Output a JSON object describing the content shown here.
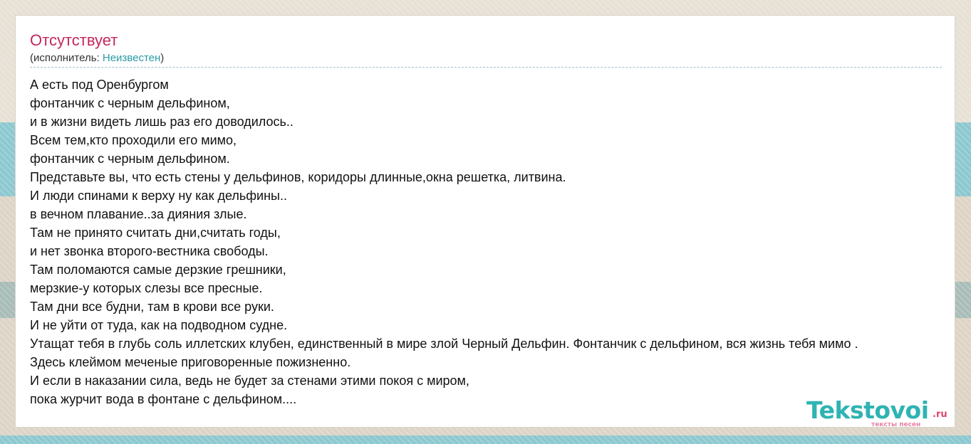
{
  "song": {
    "title": "Отсутствует",
    "artist_prefix": "(исполнитель: ",
    "artist": "Неизвестен",
    "artist_suffix": ")"
  },
  "lyrics": [
    "А есть под Оренбургом",
    "фонтанчик с черным дельфином,",
    "и в жизни видеть лишь раз его доводилось..",
    "Всем тем,кто проходили его мимо,",
    "фонтанчик с черным дельфином.",
    "Представьте вы, что есть стены у дельфинов, коридоры длинные,окна решетка, литвина.",
    "И люди спинами к верху ну как дельфины..",
    "в вечном плавание..за дияния злые.",
    "Там не принято считать дни,считать годы,",
    "и нет звонка второго-вестника свободы.",
    "Там поломаются самые дерзкие грешники,",
    "мерзкие-у которых слезы все пресные.",
    "Там дни все будни, там в крови все руки.",
    "И не уйти от туда, как на подводном судне.",
    "Утащат тебя в глубь соль иллетских клубен, единственный в мире злой Черный Дельфин. Фонтанчик с дельфином, вся жизнь тебя мимо .",
    "Здесь клеймом меченые приговоренные пожизненно.",
    "И если в наказании сила, ведь не будет за стенами этими покоя с миром,",
    "пока журчит вода в фонтане с дельфином...."
  ],
  "logo": {
    "name": "Tekstovoi",
    "tld": ".ru",
    "tagline": "тексты песен"
  },
  "colors": {
    "title": "#c4285a",
    "link": "#2a9aa6",
    "logo_main": "#2fb3b3",
    "logo_accent": "#e0456e"
  }
}
